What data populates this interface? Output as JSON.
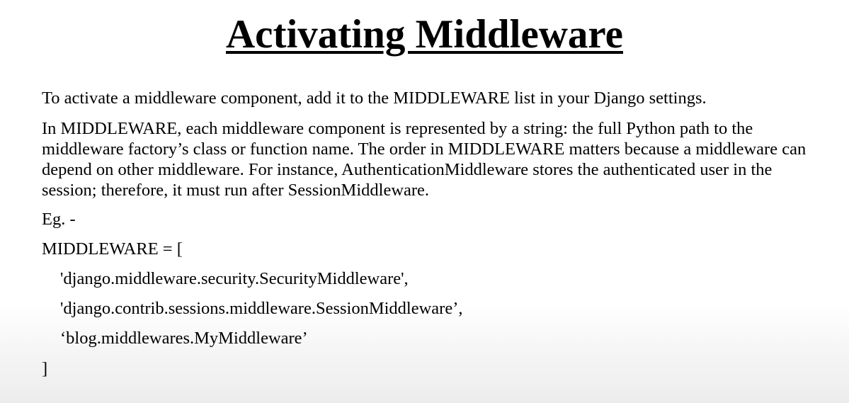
{
  "slide": {
    "title": "Activating Middleware",
    "paragraphs": [
      "To activate a middleware component, add it to the MIDDLEWARE list in your Django settings.",
      "In MIDDLEWARE, each middleware component is represented by a string: the full Python path to the middleware factory’s class or function name. The order in MIDDLEWARE matters because a middleware can depend on other middleware. For instance, AuthenticationMiddleware stores the authenticated user in the session; therefore, it must run after SessionMiddleware.",
      "Eg. -"
    ],
    "code": {
      "opening": "MIDDLEWARE = [",
      "entries": [
        "'django.middleware.security.SecurityMiddleware',",
        "'django.contrib.sessions.middleware.SessionMiddleware’,",
        "‘blog.middlewares.MyMiddleware’"
      ],
      "closing": "]"
    }
  }
}
